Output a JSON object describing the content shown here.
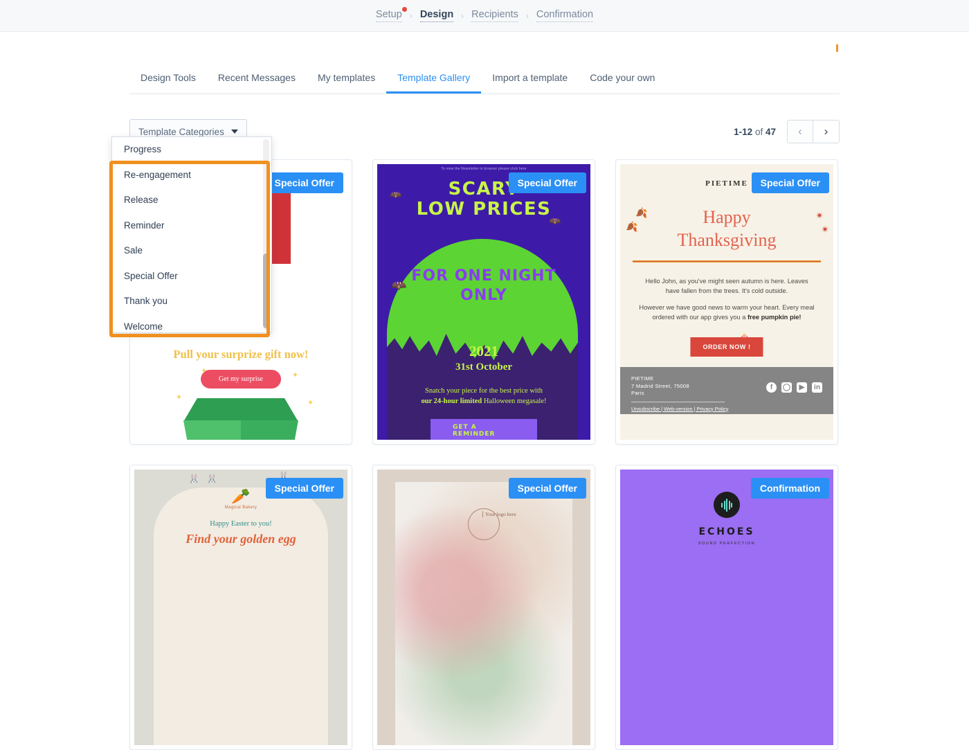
{
  "breadcrumb": {
    "items": [
      {
        "label": "Setup",
        "active": false,
        "has_dot": true
      },
      {
        "label": "Design",
        "active": true,
        "has_dot": false
      },
      {
        "label": "Recipients",
        "active": false,
        "has_dot": false
      },
      {
        "label": "Confirmation",
        "active": false,
        "has_dot": false
      }
    ],
    "separator": "›"
  },
  "tabs": {
    "items": [
      {
        "label": "Design Tools",
        "active": false
      },
      {
        "label": "Recent Messages",
        "active": false
      },
      {
        "label": "My templates",
        "active": false
      },
      {
        "label": "Template Gallery",
        "active": true
      },
      {
        "label": "Import a template",
        "active": false
      },
      {
        "label": "Code your own",
        "active": false
      }
    ],
    "active_color": "#2b90f5"
  },
  "toolbar": {
    "category_dropdown_label": "Template Categories",
    "caret_icon": "chevron-down-icon",
    "pagination": {
      "range": "1-12",
      "of_word": "of",
      "total": "47",
      "prev_icon": "‹",
      "next_icon": "›"
    }
  },
  "dropdown_menu": {
    "open": true,
    "highlight_color": "#f0901f",
    "options": [
      "Progress",
      "Re-engagement",
      "Release",
      "Reminder",
      "Sale",
      "Special Offer",
      "Thank you",
      "Welcome"
    ],
    "highlighted_from": 1,
    "highlighted_to": 7
  },
  "badge_colors": {
    "special_offer": "#2b90f5",
    "confirmation": "#2b90f5"
  },
  "templates": [
    {
      "id": "surprise-gift",
      "badge": "Special Offer",
      "title": "Pull your surprize gift now!",
      "button": "Get my surprise"
    },
    {
      "id": "halloween-scary-low-prices",
      "badge": "Special Offer",
      "preheader": "To view the Newsletter in browser please click here",
      "heading_line1": "SCARY",
      "heading_line2": "LOW PRICES",
      "subheading_line1": "FOR ONE NIGHT",
      "subheading_line2": "ONLY",
      "year": "2021",
      "date": "31st October",
      "body_line1": "Snatch your piece for the best price with",
      "body_line2_bold": "our 24-hour limited",
      "body_line2_rest": " Halloween megasale!",
      "button": "GET A REMINDER"
    },
    {
      "id": "pietime-thanksgiving",
      "badge": "Special Offer",
      "brand": "PIETIME",
      "title_line1": "Happy",
      "title_line2": "Thanksgiving",
      "paragraph1": "Hello John, as you've might seen autumn is here. Leaves have fallen from the trees. It's cold outside.",
      "paragraph2_lead": "However we have good news to warm your heart. Every meal ordered with our app gives you a ",
      "paragraph2_bold": "free pumpkin pie!",
      "button": "ORDER NOW !",
      "footer": {
        "name": "PIETIME",
        "address": "7 Madrid Street, 75008",
        "city": "Paris",
        "links": "Unsubscribe | Web-version | Privacy Policy",
        "socials": [
          "facebook-icon",
          "instagram-icon",
          "youtube-icon",
          "linkedin-icon"
        ]
      }
    },
    {
      "id": "magical-bakery-easter",
      "badge": "Special Offer",
      "brand": "Magical Bakery",
      "greeting": "Happy Easter to you!",
      "headline": "Find your golden egg"
    },
    {
      "id": "photo-your-logo",
      "badge": "Special Offer",
      "logo_text": "Your logo here"
    },
    {
      "id": "echoes-sound-perfection",
      "badge": "Confirmation",
      "brand": "ECHOES",
      "tagline": "SOUND PERFECTION"
    }
  ]
}
